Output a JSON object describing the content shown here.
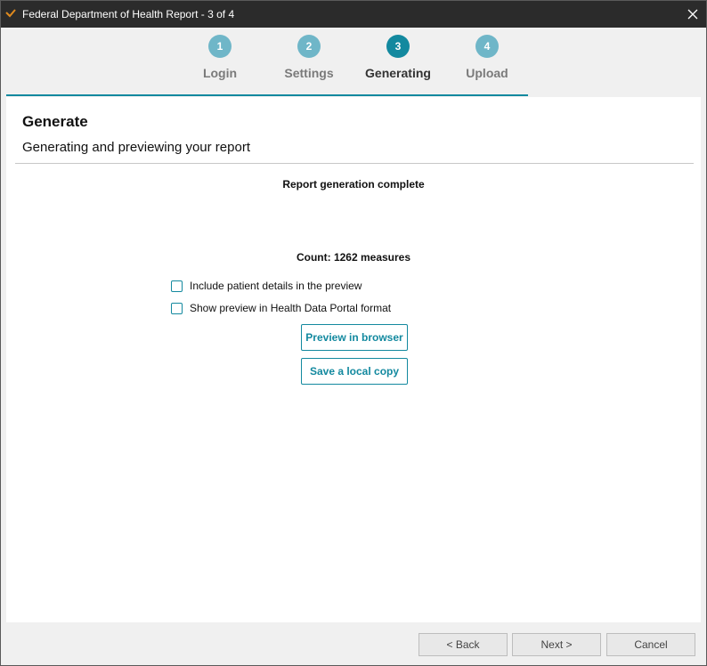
{
  "window": {
    "title": "Federal Department of Health Report - 3 of 4",
    "app_icon": "brand-check-icon",
    "close_icon": "close-icon"
  },
  "steps": [
    {
      "number": "1",
      "label": "Login",
      "state": "done"
    },
    {
      "number": "2",
      "label": "Settings",
      "state": "done"
    },
    {
      "number": "3",
      "label": "Generating",
      "state": "active"
    },
    {
      "number": "4",
      "label": "Upload",
      "state": "pending"
    }
  ],
  "page": {
    "heading": "Generate",
    "subheading": "Generating and previewing your report",
    "status": "Report generation complete",
    "count": "Count: 1262 measures"
  },
  "options": [
    {
      "label": "Include patient details in the preview",
      "checked": false
    },
    {
      "label": "Show preview in Health Data Portal format",
      "checked": false
    }
  ],
  "actions": {
    "preview": "Preview in browser",
    "save": "Save a local copy"
  },
  "footer": {
    "back": "< Back",
    "next": "Next >",
    "cancel": "Cancel"
  },
  "colors": {
    "accent": "#13899f",
    "step_inactive": "#6fb6c8",
    "titlebar": "#2b2b2b",
    "app_icon": "#e08a1e"
  }
}
